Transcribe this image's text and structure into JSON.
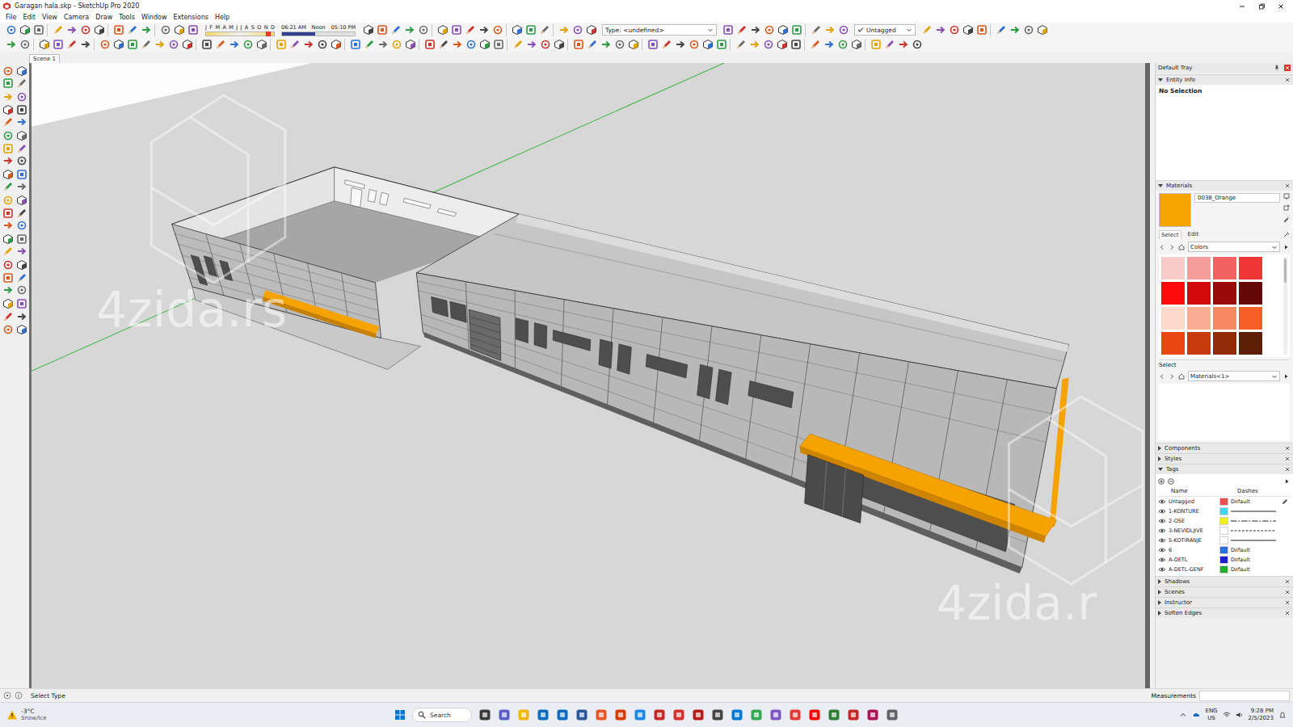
{
  "window": {
    "title": "Garagan hala.skp - SketchUp Pro 2020"
  },
  "menu": [
    "File",
    "Edit",
    "View",
    "Camera",
    "Draw",
    "Tools",
    "Window",
    "Extensions",
    "Help"
  ],
  "shadows": {
    "months": [
      "J",
      "F",
      "M",
      "A",
      "M",
      "J",
      "J",
      "A",
      "S",
      "O",
      "N",
      "D"
    ],
    "month_level": 0.92,
    "times": [
      "06:21 AM",
      "Noon",
      "05:10 PM"
    ],
    "time_level": 0.45
  },
  "type_field": "Type: <undefined>",
  "tag_dropdown": {
    "label": "Untagged",
    "checked": true
  },
  "scenes": [
    {
      "label": "Scene 1",
      "selected": true
    }
  ],
  "watermarks": [
    "4zida.rs",
    "4zida.r"
  ],
  "tray": {
    "title": "Default Tray",
    "entity_info": {
      "title": "Entity Info",
      "expanded": true,
      "text": "No Selection"
    },
    "materials": {
      "title": "Materials",
      "expanded": true,
      "current": {
        "name": "0038_Orange",
        "color": "#f7a300"
      },
      "tabs": [
        {
          "label": "Select",
          "selected": true
        },
        {
          "label": "Edit",
          "selected": false
        }
      ],
      "library": "Colors",
      "swatches": [
        {
          "color": "#f8caca"
        },
        {
          "color": "#f59c9c"
        },
        {
          "color": "#f26262"
        },
        {
          "color": "#ee3636"
        },
        {
          "color": "#fb0a0a"
        },
        {
          "color": "#d10a0a"
        },
        {
          "color": "#9c0b0b"
        },
        {
          "color": "#650808"
        },
        {
          "color": "#fcd8cc"
        },
        {
          "color": "#f9ae94"
        },
        {
          "color": "#f6895f"
        },
        {
          "color": "#f55f25"
        },
        {
          "color": "#ea4612"
        },
        {
          "color": "#c63a0b"
        },
        {
          "color": "#922b08"
        },
        {
          "color": "#5f1e07"
        }
      ],
      "select_label": "Select",
      "model_library": "Materials<1>"
    },
    "sections_before": [
      {
        "title": "Components",
        "expanded": false
      },
      {
        "title": "Styles",
        "expanded": false
      }
    ],
    "tags": {
      "title": "Tags",
      "expanded": true,
      "columns": [
        "Name",
        "Dashes"
      ],
      "rows": [
        {
          "name": "Untagged",
          "visible": true,
          "current": true,
          "color": "#e8504c",
          "kind": "text",
          "dashes": "Default"
        },
        {
          "name": "1-KONTURE",
          "visible": true,
          "current": false,
          "color": "#3fd6f2",
          "kind": "solid"
        },
        {
          "name": "2-OSE",
          "visible": true,
          "current": false,
          "color": "#f2ee1c",
          "kind": "dashdot"
        },
        {
          "name": "3-NEVIDLJIVE",
          "visible": true,
          "current": false,
          "color": "#ffffff",
          "kind": "dashed"
        },
        {
          "name": "5-KOTIRANJE",
          "visible": true,
          "current": false,
          "color": "#ffffff",
          "kind": "solid"
        },
        {
          "name": "6",
          "visible": true,
          "current": false,
          "color": "#2a6fe0",
          "kind": "text",
          "dashes": "Default"
        },
        {
          "name": "A-DETL",
          "visible": true,
          "current": false,
          "color": "#1c1fd0",
          "kind": "text",
          "dashes": "Default"
        },
        {
          "name": "A-DETL-GENF",
          "visible": true,
          "current": false,
          "color": "#1fae2b",
          "kind": "text",
          "dashes": "Default"
        }
      ]
    },
    "sections_after": [
      {
        "title": "Shadows",
        "expanded": false
      },
      {
        "title": "Scenes",
        "expanded": false
      },
      {
        "title": "Instructor",
        "expanded": false
      },
      {
        "title": "Soften Edges",
        "expanded": false
      }
    ]
  },
  "status_bar": {
    "text": "Select Type",
    "measurements_label": "Measurements"
  },
  "taskbar": {
    "weather": {
      "temp": "-3°C",
      "condition": "Snow/Ice"
    },
    "search": "Search",
    "language": [
      "ENG",
      "US"
    ],
    "time": "9:28 PM",
    "date": "2/5/2023"
  }
}
